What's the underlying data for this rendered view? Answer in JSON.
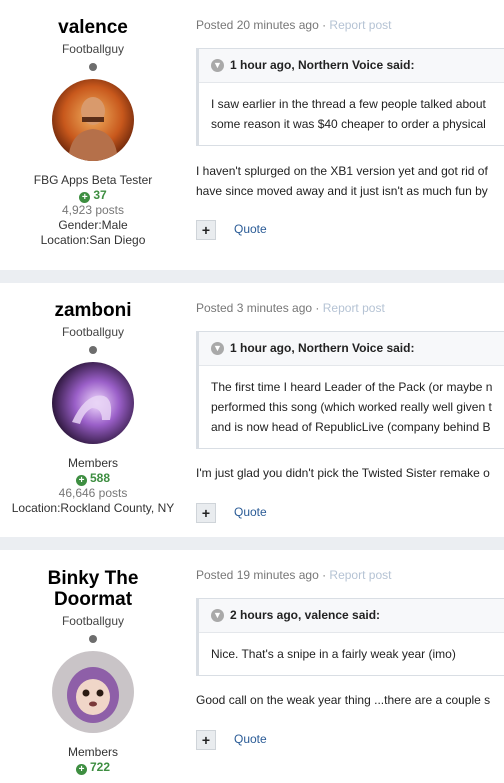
{
  "posts": [
    {
      "author": {
        "name_lines": [
          "valence"
        ],
        "title": "Footballguy",
        "meta_lines_before_rep": [
          "FBG Apps Beta Tester"
        ],
        "reputation": "37",
        "post_count": "4,923 posts",
        "meta_lines_after": [
          "Gender:Male",
          "Location:San Diego"
        ]
      },
      "posted": "Posted 20 minutes ago",
      "report": "Report post",
      "quote": {
        "header": "1 hour ago, Northern Voice said:",
        "lines": [
          "I saw earlier in the thread a few people talked about",
          "some reason it was $40 cheaper to order a physical"
        ]
      },
      "body_lines": [
        "I haven't splurged on the XB1 version yet and got rid of",
        "have since moved away and it just isn't as much fun by"
      ],
      "actions": {
        "plus": "+",
        "quote": "Quote"
      }
    },
    {
      "author": {
        "name_lines": [
          "zamboni"
        ],
        "title": "Footballguy",
        "meta_lines_before_rep": [
          "Members"
        ],
        "reputation": "588",
        "post_count": "46,646 posts",
        "meta_lines_after": [
          "Location:Rockland County, NY"
        ]
      },
      "posted": "Posted 3 minutes ago",
      "report": "Report post",
      "quote": {
        "header": "1 hour ago, Northern Voice said:",
        "lines": [
          "The first time I heard Leader of the Pack (or maybe n",
          "performed this song (which worked really well given t",
          "and is now head of RepublicLive (company behind B"
        ]
      },
      "body_lines": [
        "I'm just glad you didn't pick the Twisted Sister remake o"
      ],
      "actions": {
        "plus": "+",
        "quote": "Quote"
      }
    },
    {
      "author": {
        "name_lines": [
          "Binky The",
          "Doormat"
        ],
        "title": "Footballguy",
        "meta_lines_before_rep": [
          "Members"
        ],
        "reputation": "722",
        "post_count": "",
        "meta_lines_after": []
      },
      "posted": "Posted 19 minutes ago",
      "report": "Report post",
      "quote": {
        "header": "2 hours ago, valence said:",
        "lines": [
          "Nice. That's a snipe in a fairly weak year (imo)"
        ]
      },
      "body_lines": [
        "Good call on the weak year thing ...there are a couple s"
      ],
      "actions": {
        "plus": "+",
        "quote": "Quote"
      }
    }
  ],
  "separator": " · "
}
